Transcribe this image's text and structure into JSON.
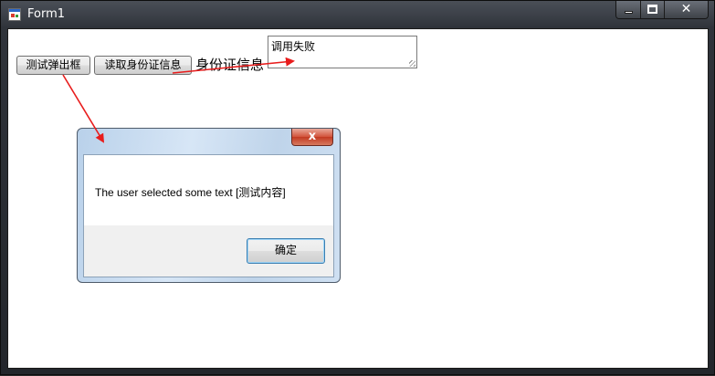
{
  "window": {
    "title": "Form1",
    "ghost_title": "..."
  },
  "form": {
    "popup_button_label": "测试弹出框",
    "read_id_button_label": "读取身份证信息",
    "id_info_label": "身份证信息",
    "result_textbox_value": "调用失败"
  },
  "dialog": {
    "close_glyph": "x",
    "message": "The user selected some text [测试内容]",
    "ok_button_label": "确定"
  },
  "annotations": {
    "arrow_color": "#e81c1c"
  }
}
